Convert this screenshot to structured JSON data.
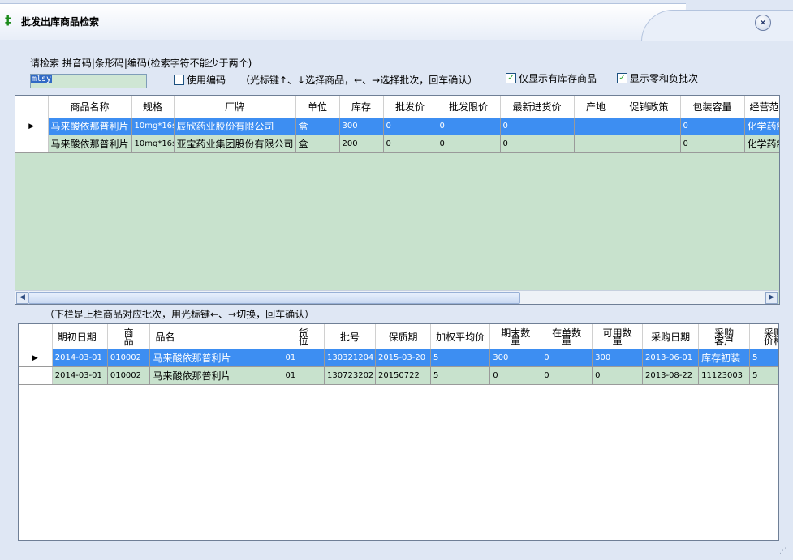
{
  "window": {
    "title": "批发出库商品检索",
    "close_label": "×"
  },
  "search": {
    "hint": "请检索 拼音码|条形码|编码(检索字符不能少于两个)",
    "value": "mlsy"
  },
  "options": {
    "use_code": {
      "label": "使用编码",
      "checked": false
    },
    "instructions": "（光标键↑、↓选择商品，←、→选择批次，回车确认）",
    "only_in_stock": {
      "label": "仅显示有库存商品",
      "checked": true
    },
    "show_zero_negative": {
      "label": "显示零和负批次",
      "checked": true
    }
  },
  "product_grid": {
    "columns": [
      "商品名称",
      "规格",
      "厂牌",
      "单位",
      "库存",
      "批发价",
      "批发限价",
      "最新进货价",
      "产地",
      "促销政策",
      "包装容量",
      "经营范"
    ],
    "rows": [
      [
        "马来酸依那普利片",
        "10mg*16s",
        "辰欣药业股份有限公司",
        "盒",
        "300",
        "0",
        "0",
        "0",
        "",
        "",
        "0",
        "化学药制"
      ],
      [
        "马来酸依那普利片",
        "10mg*16s",
        "亚宝药业集团股份有限公司",
        "盒",
        "200",
        "0",
        "0",
        "0",
        "",
        "",
        "0",
        "化学药制"
      ]
    ],
    "selected_row": 0
  },
  "batch_note": "（下栏是上栏商品对应批次，用光标键←、→切换，回车确认）",
  "batch_grid": {
    "columns": [
      "期初日期",
      "商品",
      "品名",
      "货位",
      "批号",
      "保质期",
      "加权平均价",
      "期末数量",
      "在单数量",
      "可用数量",
      "采购日期",
      "采购客户",
      "采购价格"
    ],
    "rows": [
      [
        "2014-03-01",
        "010002",
        "马来酸依那普利片",
        "01",
        "130321204",
        "2015-03-20",
        "5",
        "300",
        "0",
        "300",
        "2013-06-01",
        "库存初装",
        "5"
      ],
      [
        "2014-03-01",
        "010002",
        "马来酸依那普利片",
        "01",
        "130723202",
        "20150722",
        "5",
        "0",
        "0",
        "0",
        "2013-08-22",
        "11123003",
        "5"
      ]
    ],
    "selected_row": 0
  }
}
